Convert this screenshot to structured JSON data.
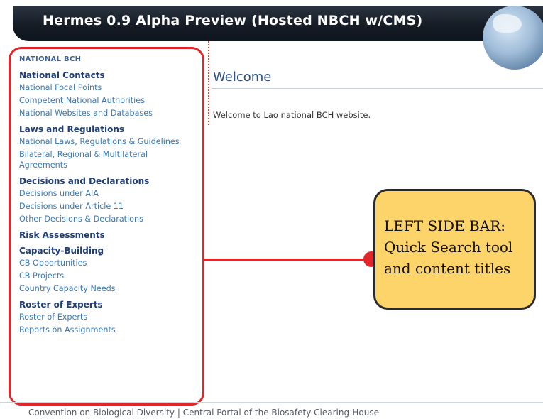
{
  "header": {
    "title": "Hermes 0.9 Alpha Preview (Hosted NBCH w/CMS)",
    "globe_icon": "globe-icon"
  },
  "sidebar": {
    "site_label": "NATIONAL BCH",
    "sections": [
      {
        "heading": "National Contacts",
        "links": [
          "National Focal Points",
          "Competent National Authorities",
          "National Websites and Databases"
        ]
      },
      {
        "heading": "Laws and Regulations",
        "links": [
          "National Laws, Regulations & Guidelines",
          "Bilateral, Regional & Multilateral Agreements"
        ]
      },
      {
        "heading": "Decisions and Declarations",
        "links": [
          "Decisions under AIA",
          "Decisions under Article 11",
          "Other Decisions & Declarations"
        ]
      },
      {
        "heading": "Risk Assessments",
        "links": []
      },
      {
        "heading": "Capacity-Building",
        "links": [
          "CB Opportunities",
          "CB Projects",
          "Country Capacity Needs"
        ]
      },
      {
        "heading": "Roster of Experts",
        "links": [
          "Roster of Experts",
          "Reports on Assignments"
        ]
      }
    ]
  },
  "main": {
    "title": "Welcome",
    "text": "Welcome to Lao national BCH website."
  },
  "callout": {
    "line1": "LEFT SIDE BAR:",
    "line2": "Quick Search tool",
    "line3": "and content titles"
  },
  "footer": {
    "link1": "Convention on Biological Diversity",
    "separator": "|",
    "link2": "Central Portal of the Biosafety Clearing-House"
  },
  "colors": {
    "highlight": "#e0262b",
    "callout_fill": "#fdd46a",
    "link": "#3a78b8",
    "heading": "#1f3d76"
  }
}
